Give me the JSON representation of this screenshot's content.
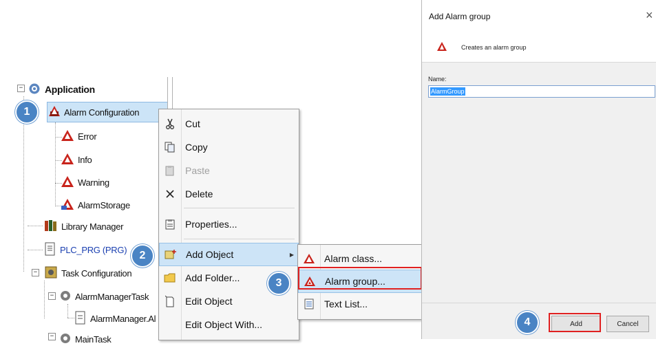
{
  "tree": {
    "application": "Application",
    "alarm_configuration": "Alarm Configuration",
    "error": "Error",
    "info": "Info",
    "warning": "Warning",
    "alarm_storage": "AlarmStorage",
    "library_manager": "Library Manager",
    "plc_prg": "PLC_PRG (PRG)",
    "task_configuration": "Task Configuration",
    "alarm_manager_task": "AlarmManagerTask",
    "alarm_manager_call": "AlarmManager.Al",
    "main_task": "MainTask"
  },
  "context_menu": {
    "cut": "Cut",
    "copy": "Copy",
    "paste": "Paste",
    "delete": "Delete",
    "properties": "Properties...",
    "add_object": "Add Object",
    "add_folder": "Add Folder...",
    "edit_object": "Edit Object",
    "edit_object_with": "Edit Object With..."
  },
  "submenu": {
    "alarm_class": "Alarm class...",
    "alarm_group": "Alarm group...",
    "text_list": "Text List..."
  },
  "dialog": {
    "title": "Add Alarm group",
    "close": "×",
    "description": "Creates an alarm group",
    "name_label": "Name:",
    "name_value": "AlarmGroup",
    "add_button": "Add",
    "cancel_button": "Cancel"
  },
  "badges": [
    "1",
    "2",
    "3",
    "4"
  ],
  "colors": {
    "badge": "#4a84c4",
    "highlight_box": "#e02020",
    "menu_highlight": "#cde4f7",
    "selection": "#3399ff",
    "plc_prg_text": "#1a3fb0"
  }
}
